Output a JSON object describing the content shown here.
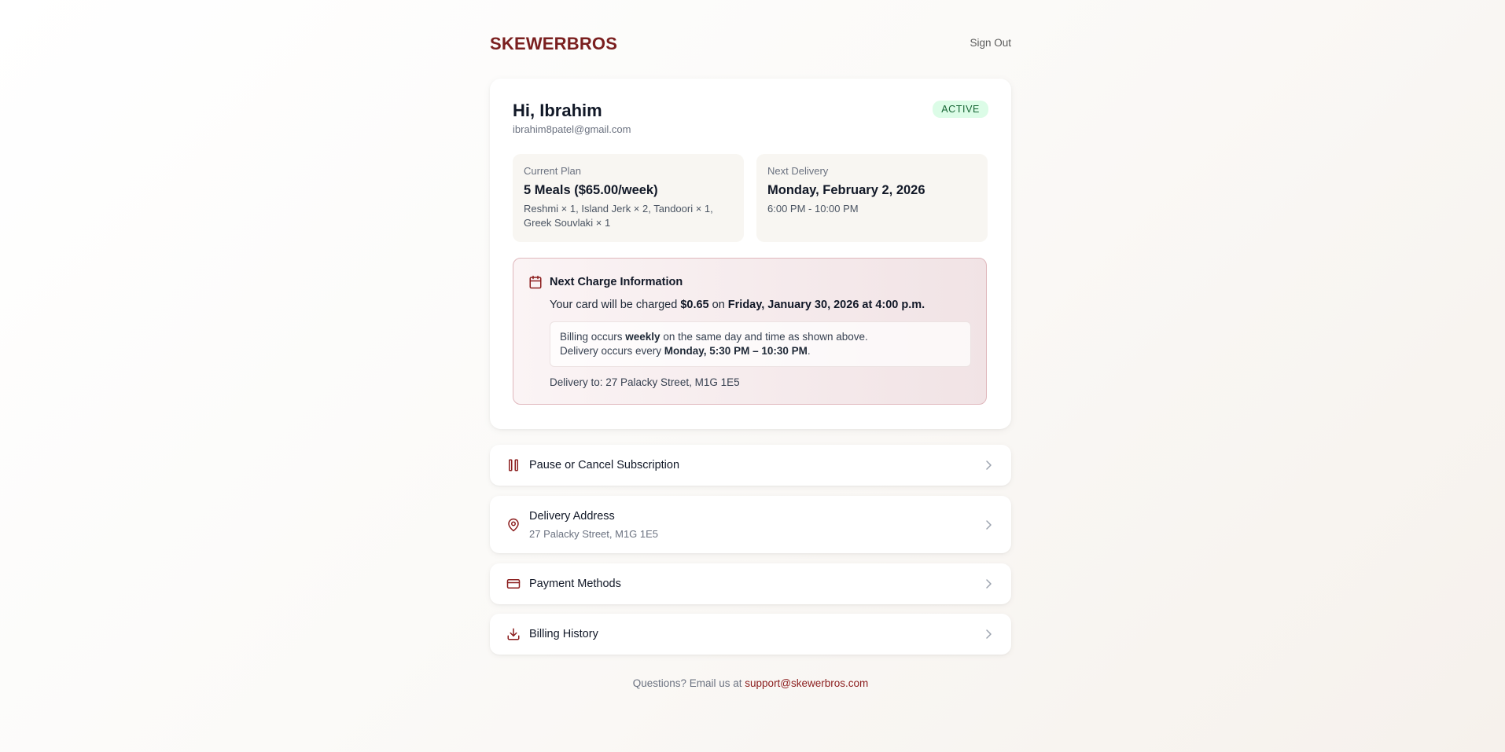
{
  "header": {
    "brand": "SKEWERBROS",
    "sign_out": "Sign Out"
  },
  "account": {
    "greeting": "Hi, Ibrahim",
    "email": "ibrahim8patel@gmail.com",
    "status": "ACTIVE"
  },
  "plan": {
    "label": "Current Plan",
    "value": "5 Meals ($65.00/week)",
    "items": "Reshmi × 1, Island Jerk × 2, Tandoori × 1, Greek Souvlaki × 1"
  },
  "delivery": {
    "label": "Next Delivery",
    "date": "Monday, February 2, 2026",
    "window": "6:00 PM - 10:00 PM"
  },
  "charge": {
    "title": "Next Charge Information",
    "text_prefix": "Your card will be charged ",
    "amount": "$0.65",
    "text_mid": " on ",
    "when": "Friday, January 30, 2026 at 4:00 p.m.",
    "billing_prefix": "Billing occurs ",
    "billing_freq": "weekly",
    "billing_suffix": " on the same day and time as shown above.",
    "delivery_prefix": "Delivery occurs every ",
    "delivery_when": "Monday, 5:30 PM – 10:30 PM",
    "delivery_suffix": ".",
    "delivery_to": "Delivery to: 27 Palacky Street, M1G 1E5"
  },
  "menu": [
    {
      "title": "Pause or Cancel Subscription",
      "icon": "pause-icon"
    },
    {
      "title": "Delivery Address",
      "subtitle": "27 Palacky Street, M1G 1E5",
      "icon": "map-pin-icon"
    },
    {
      "title": "Payment Methods",
      "icon": "credit-card-icon"
    },
    {
      "title": "Billing History",
      "icon": "download-icon"
    }
  ],
  "footer": {
    "text": "Questions? Email us at ",
    "email": "support@skewerbros.com"
  },
  "colors": {
    "brand": "#7a1f1f",
    "accent_icon": "#8b1d1d",
    "active_badge_bg": "#dcfce7",
    "active_badge_text": "#166534"
  }
}
